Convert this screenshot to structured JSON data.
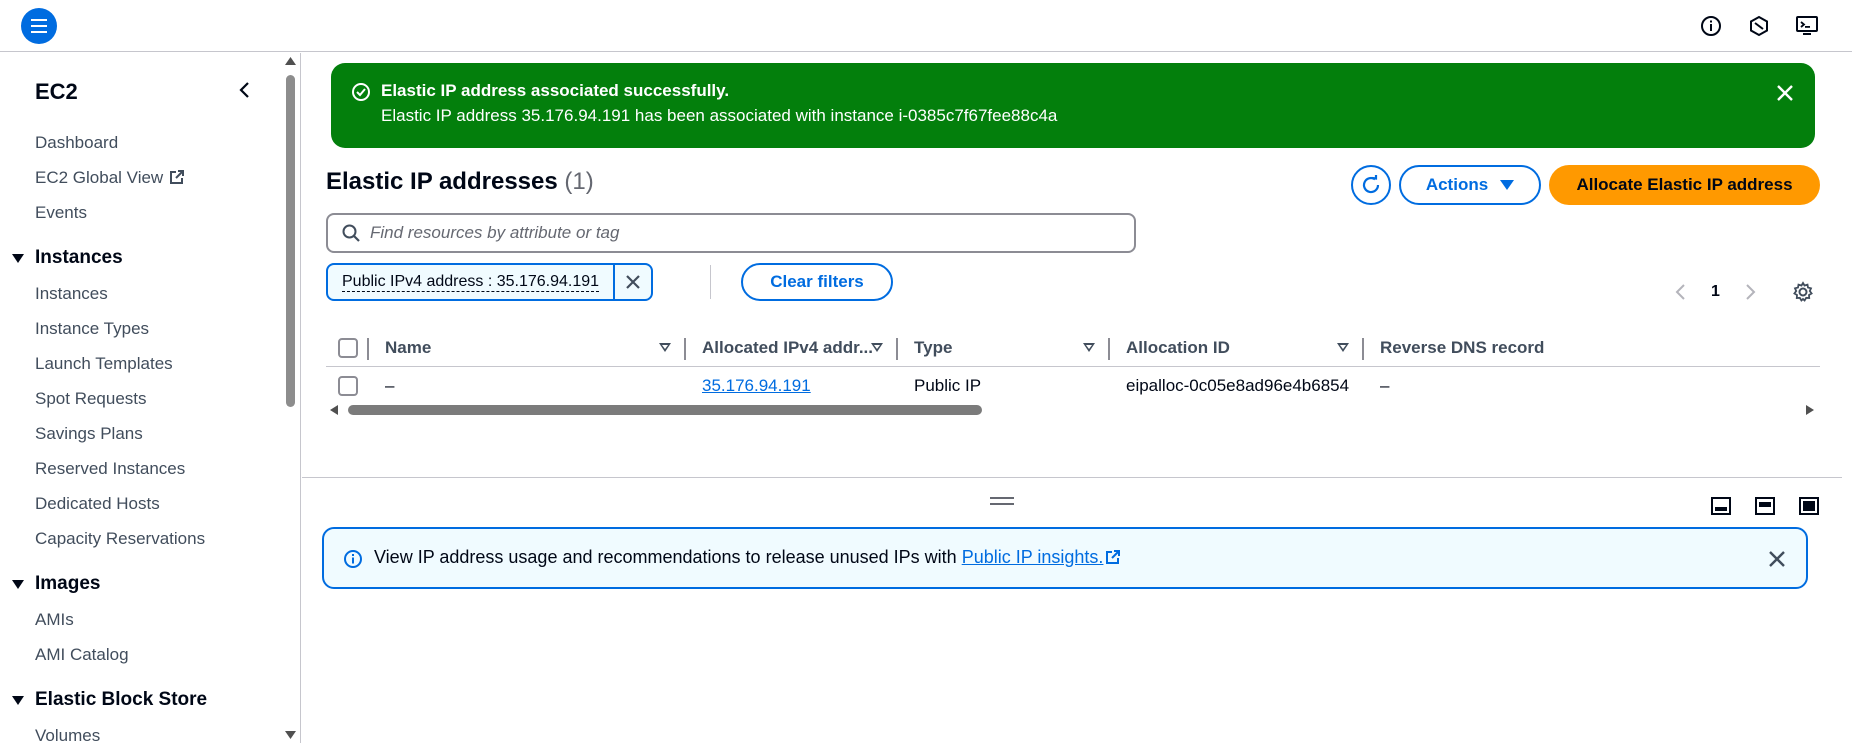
{
  "topbar": {
    "menu_icon": "hamburger-menu-icon",
    "icons": [
      "info-icon",
      "notifications-icon",
      "cloudshell-icon"
    ]
  },
  "sidebar": {
    "title": "EC2",
    "links_top": [
      {
        "label": "Dashboard"
      },
      {
        "label": "EC2 Global View",
        "external": true
      },
      {
        "label": "Events"
      }
    ],
    "sections": [
      {
        "label": "Instances",
        "items": [
          "Instances",
          "Instance Types",
          "Launch Templates",
          "Spot Requests",
          "Savings Plans",
          "Reserved Instances",
          "Dedicated Hosts",
          "Capacity Reservations"
        ]
      },
      {
        "label": "Images",
        "items": [
          "AMIs",
          "AMI Catalog"
        ]
      },
      {
        "label": "Elastic Block Store",
        "items": [
          "Volumes"
        ]
      }
    ]
  },
  "flash": {
    "title": "Elastic IP address associated successfully.",
    "message": "Elastic IP address 35.176.94.191 has been associated with instance i-0385c7f67fee88c4a",
    "color": "#037f0c"
  },
  "header": {
    "title": "Elastic IP addresses",
    "count": "(1)",
    "actions_label": "Actions",
    "allocate_label": "Allocate Elastic IP address"
  },
  "search": {
    "placeholder": "Find resources by attribute or tag"
  },
  "filter": {
    "token": "Public IPv4 address : 35.176.94.191",
    "clear_label": "Clear filters"
  },
  "pagination": {
    "current_page": "1"
  },
  "table": {
    "columns": [
      "Name",
      "Allocated IPv4 addr...",
      "Type",
      "Allocation ID",
      "Reverse DNS record"
    ],
    "rows": [
      {
        "name": "–",
        "ip": "35.176.94.191",
        "type": "Public IP",
        "allocation_id": "eipalloc-0c05e8ad96e4b6854",
        "reverse_dns": "–"
      }
    ]
  },
  "info_alert": {
    "text": "View IP address usage and recommendations to release unused IPs with ",
    "link": "Public IP insights."
  },
  "colors": {
    "accent": "#006ce0",
    "primary_button": "#ff9900",
    "success": "#037f0c"
  }
}
